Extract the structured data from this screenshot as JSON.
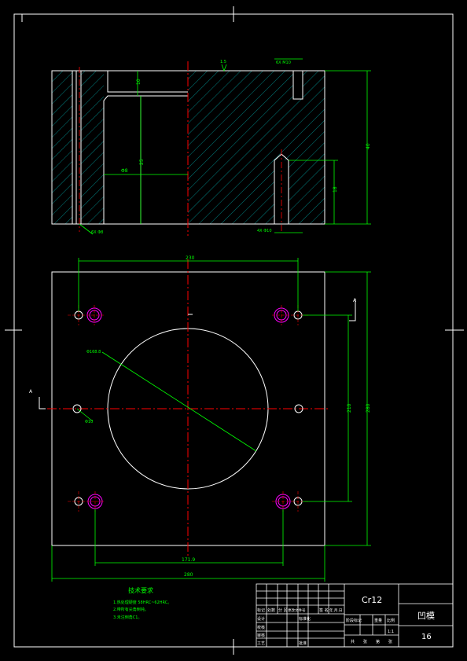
{
  "drawing": {
    "material": "Cr12",
    "part_name": "凹模",
    "scale": "1:1",
    "sheet_no": "16"
  },
  "title_block": {
    "labels": [
      "标记",
      "处数",
      "分 区",
      "更改文件号",
      "签 名",
      "年.月.日",
      "设计",
      "标准化",
      "校核",
      "审核",
      "工艺",
      "批准",
      "阶段标记",
      "重量",
      "比例",
      "共",
      "张",
      "第",
      "张"
    ]
  },
  "notes": {
    "title": "技术要求",
    "lines": [
      "1.热处理硬度 58HRC~62HRC。",
      "2.带所有尖角倒钝。",
      "3.未注倒角C1。"
    ]
  },
  "dimensions": {
    "top_pin_offset": "10",
    "height_total": "40",
    "height_inner": "25",
    "hole_depth": "18",
    "bore_dia": "Φ8",
    "counterbore_top": "6X M10",
    "counterbore_bottom": "4X Φ10",
    "plate_width": "280",
    "inner_hole_span": "230",
    "pitch_bottom": "171.9",
    "plate_height": "280",
    "vertical_span": "210",
    "circle_dia": "Φ168.8",
    "small_hole_dia": "Φ10",
    "section_mark": "A",
    "chamfer": "1.5",
    "bottom_chamfer": "6X Φ8"
  },
  "colors": {
    "outline": "#ffffff",
    "hatch": "#00a0a0",
    "dimension": "#00ff00",
    "center": "#ff0000",
    "screw": "#ff00ff"
  }
}
